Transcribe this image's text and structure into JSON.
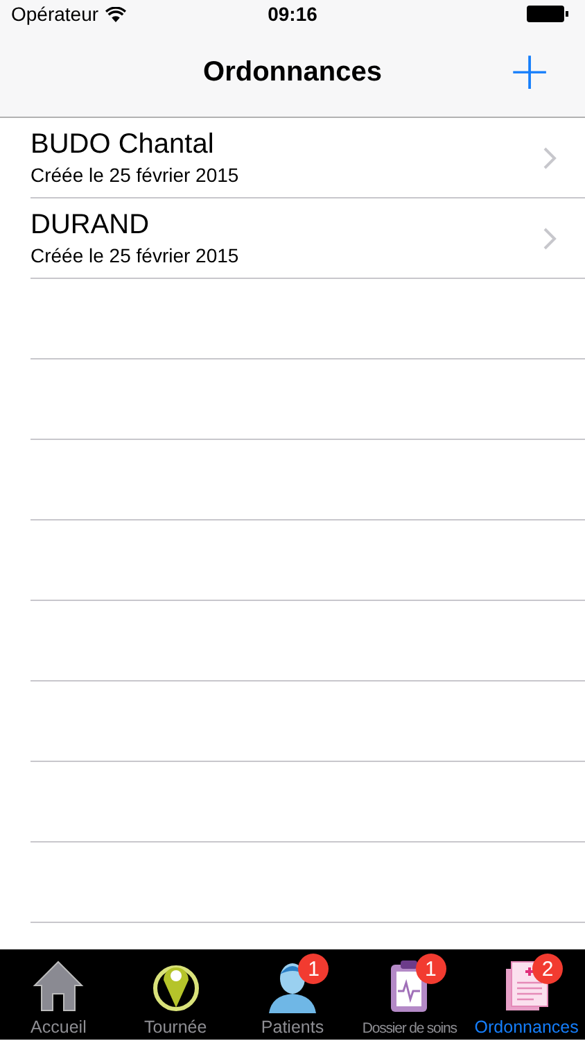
{
  "status_bar": {
    "carrier": "Opérateur",
    "time": "09:16"
  },
  "nav_bar": {
    "title": "Ordonnances",
    "add_button": "+"
  },
  "prescriptions": [
    {
      "name": "BUDO Chantal",
      "created": "Créée le 25 février 2015"
    },
    {
      "name": "DURAND",
      "created": "Créée le 25 février 2015"
    }
  ],
  "tab_bar": [
    {
      "kind": "home",
      "label": "Accueil",
      "selected": false
    },
    {
      "kind": "route",
      "label": "Tournée",
      "selected": false
    },
    {
      "kind": "patient",
      "label": "Patients",
      "badge": "1",
      "selected": false
    },
    {
      "kind": "clipboard",
      "label": "Dossier de soins",
      "badge": "1",
      "selected": false
    },
    {
      "kind": "prescription",
      "label": "Ordonnances",
      "badge": "2",
      "selected": true
    }
  ]
}
